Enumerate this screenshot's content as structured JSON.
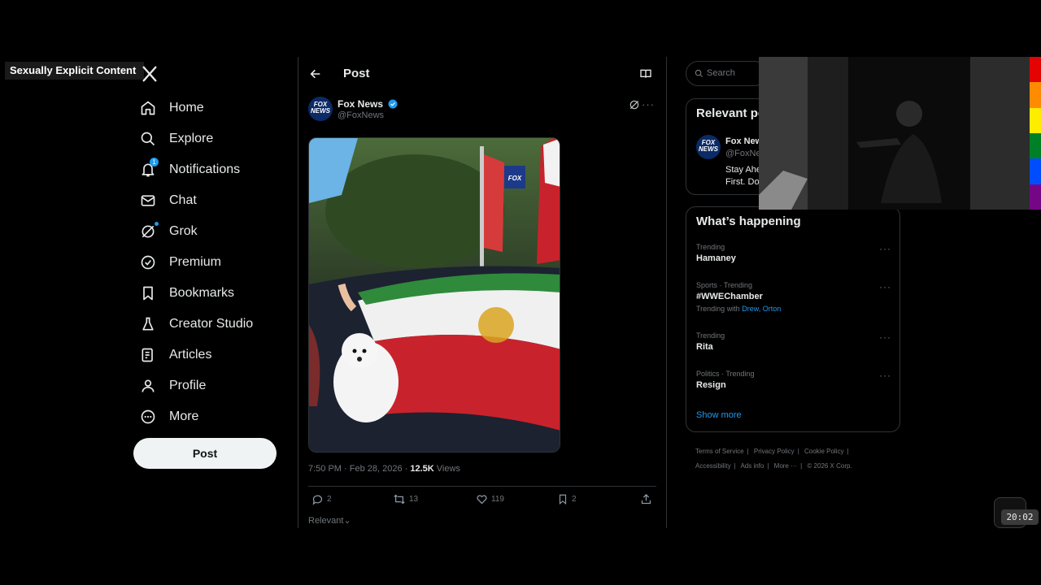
{
  "overlay_label": "Sexually Explicit Content",
  "nav": {
    "items": [
      {
        "label": "Home",
        "icon": "home-icon"
      },
      {
        "label": "Explore",
        "icon": "search-icon"
      },
      {
        "label": "Notifications",
        "icon": "bell-icon",
        "badge": "1"
      },
      {
        "label": "Chat",
        "icon": "mail-icon"
      },
      {
        "label": "Grok",
        "icon": "grok-icon"
      },
      {
        "label": "Premium",
        "icon": "verified-badge-icon"
      },
      {
        "label": "Bookmarks",
        "icon": "bookmark-icon"
      },
      {
        "label": "Creator Studio",
        "icon": "flask-icon"
      },
      {
        "label": "Articles",
        "icon": "article-icon"
      },
      {
        "label": "Profile",
        "icon": "person-icon"
      },
      {
        "label": "More",
        "icon": "more-circle-icon"
      }
    ],
    "post_button": "Post"
  },
  "header": {
    "title": "Post"
  },
  "post": {
    "author_name": "Fox News",
    "author_handle": "@FoxNews",
    "avatar_text": "FOX NEWS",
    "timestamp": "7:50 PM · Feb 28, 2026 · ",
    "views_count": "12.5K",
    "views_label": " Views",
    "actions": {
      "replies": "2",
      "reposts": "13",
      "likes": "119",
      "bookmarks": "2"
    },
    "sort": "Relevant"
  },
  "search": {
    "placeholder": "Search"
  },
  "relevant_people": {
    "title": "Relevant people",
    "name": "Fox News",
    "handle": "@FoxNews",
    "bio_line1": "Stay Ahead",
    "bio_line2": "First. Do"
  },
  "whats_happening": {
    "title": "What’s happening",
    "trends": [
      {
        "meta": "Trending",
        "topic": "Hamaney"
      },
      {
        "meta": "Sports · Trending",
        "topic": "#WWEChamber",
        "with_prefix": "Trending with ",
        "with_links": "Drew, Orton"
      },
      {
        "meta": "Trending",
        "topic": "Rita"
      },
      {
        "meta": "Politics · Trending",
        "topic": "Resign"
      }
    ],
    "show_more": "Show more"
  },
  "footer": {
    "links": [
      "Terms of Service",
      "Privacy Policy",
      "Cookie Policy",
      "Accessibility",
      "Ads info",
      "More ···"
    ],
    "copyright": "© 2026 X Corp."
  },
  "clock": "20:02",
  "colors": {
    "accent": "#1d9bf0",
    "background": "#000000",
    "border": "#2f3336"
  }
}
